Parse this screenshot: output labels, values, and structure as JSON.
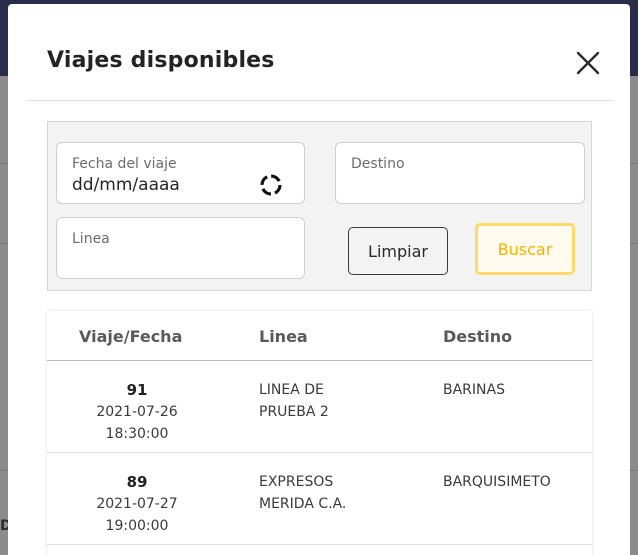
{
  "modal": {
    "title": "Viajes disponibles"
  },
  "filters": {
    "date": {
      "label": "Fecha del viaje",
      "value": "dd/mm/aaaa"
    },
    "destination": {
      "label": "Destino",
      "value": ""
    },
    "line": {
      "label": "Linea",
      "value": ""
    },
    "clear_label": "Limpiar",
    "search_label": "Buscar"
  },
  "table": {
    "headers": {
      "trip": "Viaje/Fecha",
      "line": "Linea",
      "destination": "Destino"
    },
    "rows": [
      {
        "trip": "91",
        "date": "2021-07-26",
        "time": "18:30:00",
        "line_1": "LINEA DE",
        "line_2": "PRUEBA 2",
        "destination": "BARINAS"
      },
      {
        "trip": "89",
        "date": "2021-07-27",
        "time": "19:00:00",
        "line_1": "EXPRESOS",
        "line_2": "MERIDA C.A.",
        "destination": "BARQUISIMETO"
      }
    ]
  },
  "background": {
    "partial_letter": "D"
  },
  "colors": {
    "accent": "#f4b400",
    "accent_border": "#ffd96a",
    "topbar": "#2a2d4a"
  },
  "icons": {
    "close": "close-icon",
    "spinner": "loading-spinner-icon"
  }
}
